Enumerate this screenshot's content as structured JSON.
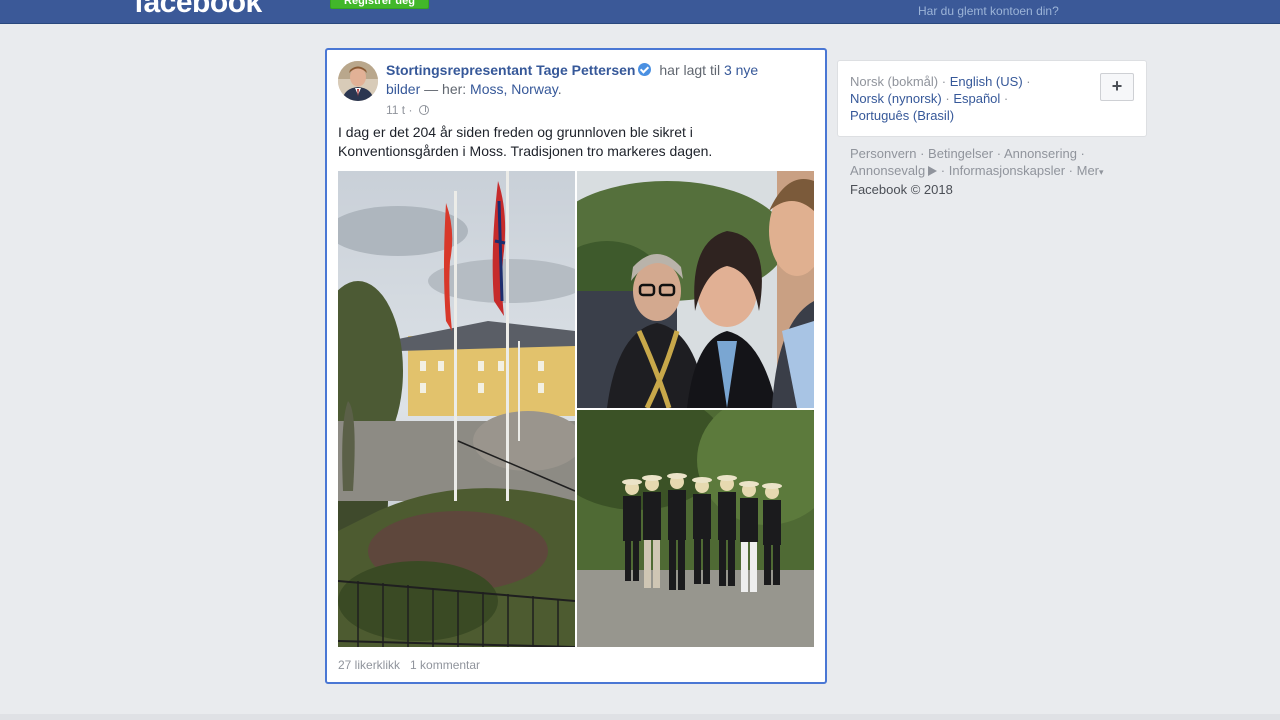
{
  "header": {
    "logo": "facebook",
    "signup_label": "Registrer deg",
    "forgot_link": "Har du glemt kontoen din?"
  },
  "post": {
    "author": "Stortingsrepresentant Tage Pettersen",
    "action_text": " har lagt til ",
    "photos_link": "3 nye bilder",
    "location_prefix": " — her: ",
    "location": "Moss, Norway",
    "location_suffix": ".",
    "timestamp": "11 t",
    "separator": " · ",
    "text": "I dag er det 204 år siden freden og grunnloven ble sikret i Konventionsgården i Moss. Tradisjonen tro markeres dagen.",
    "likes": "27 likerklikk",
    "comments": "1 kommentar"
  },
  "languages": {
    "current": "Norsk (bokmål)",
    "options": [
      "English (US)",
      "Norsk (nynorsk)",
      "Español",
      "Português (Brasil)"
    ],
    "sep": " · ",
    "plus": "+"
  },
  "footer": {
    "links": [
      "Personvern",
      "Betingelser",
      "Annonsering",
      "Annonsevalg",
      "Informasjonskapsler",
      "Mer"
    ],
    "more_caret": "▾",
    "copyright": "Facebook © 2018"
  },
  "colors": {
    "brand": "#3b5998",
    "link": "#365899",
    "focus_border": "#4a77d4",
    "signup": "#42b72a"
  }
}
